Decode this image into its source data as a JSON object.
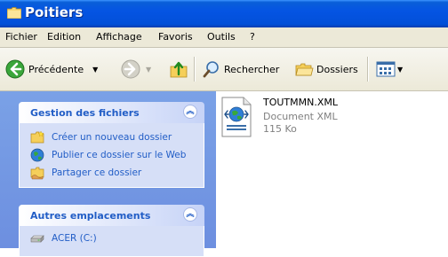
{
  "window": {
    "title": "Poitiers"
  },
  "menu": [
    {
      "label": "Fichier"
    },
    {
      "label": "Edition"
    },
    {
      "label": "Affichage"
    },
    {
      "label": "Favoris"
    },
    {
      "label": "Outils"
    },
    {
      "label": "?"
    }
  ],
  "toolbar": {
    "back_label": "Précédente",
    "search_label": "Rechercher",
    "folders_label": "Dossiers"
  },
  "left_pane": {
    "file_tasks": {
      "title": "Gestion des fichiers",
      "items": [
        {
          "label": "Créer un nouveau dossier",
          "icon": "new-folder-icon"
        },
        {
          "label": "Publier ce dossier sur le Web",
          "icon": "publish-web-icon"
        },
        {
          "label": "Partager ce dossier",
          "icon": "share-folder-icon"
        }
      ]
    },
    "other_places": {
      "title": "Autres emplacements",
      "items": [
        {
          "label": "ACER (C:)",
          "icon": "drive-icon"
        }
      ]
    }
  },
  "file": {
    "name": "TOUTMMN.XML",
    "type": "Document XML",
    "size": "115 Ko"
  },
  "colors": {
    "titlebar": "#0554e3",
    "pane_bg": "#6d8fe0",
    "task_link": "#215dc6",
    "menubar_bg": "#ece9d8"
  }
}
